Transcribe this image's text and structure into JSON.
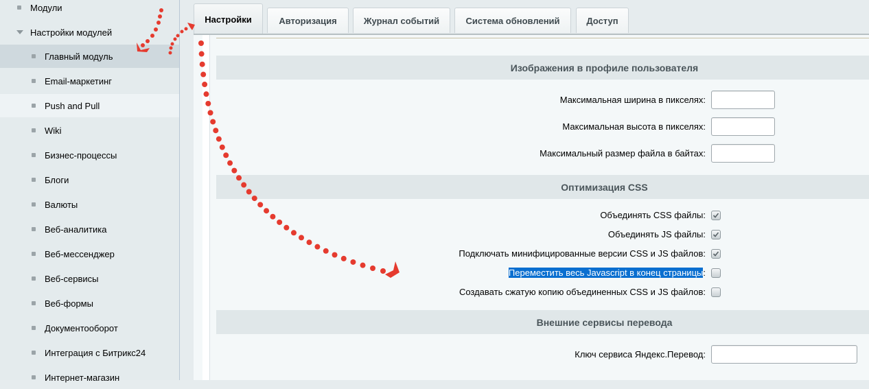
{
  "sidebar": {
    "items": [
      {
        "label": "Модули",
        "level": 1,
        "type": "bullet"
      },
      {
        "label": "Настройки модулей",
        "level": 1,
        "type": "expanded"
      },
      {
        "label": "Главный модуль",
        "level": 2,
        "type": "bullet",
        "state": "selected"
      },
      {
        "label": "Email-маркетинг",
        "level": 2,
        "type": "bullet"
      },
      {
        "label": "Push and Pull",
        "level": 2,
        "type": "bullet",
        "state": "hover"
      },
      {
        "label": "Wiki",
        "level": 2,
        "type": "bullet"
      },
      {
        "label": "Бизнес-процессы",
        "level": 2,
        "type": "bullet"
      },
      {
        "label": "Блоги",
        "level": 2,
        "type": "bullet"
      },
      {
        "label": "Валюты",
        "level": 2,
        "type": "bullet"
      },
      {
        "label": "Веб-аналитика",
        "level": 2,
        "type": "bullet"
      },
      {
        "label": "Веб-мессенджер",
        "level": 2,
        "type": "bullet"
      },
      {
        "label": "Веб-сервисы",
        "level": 2,
        "type": "bullet"
      },
      {
        "label": "Веб-формы",
        "level": 2,
        "type": "bullet"
      },
      {
        "label": "Документооборот",
        "level": 2,
        "type": "bullet"
      },
      {
        "label": "Интеграция с Битрикс24",
        "level": 2,
        "type": "bullet"
      },
      {
        "label": "Интернет-магазин",
        "level": 2,
        "type": "bullet"
      }
    ]
  },
  "tabs": [
    {
      "label": "Настройки",
      "active": true
    },
    {
      "label": "Авторизация",
      "active": false
    },
    {
      "label": "Журнал событий",
      "active": false
    },
    {
      "label": "Система обновлений",
      "active": false
    },
    {
      "label": "Доступ",
      "active": false
    }
  ],
  "sections": {
    "images": {
      "title": "Изображения в профиле пользователя",
      "fields": [
        {
          "label": "Максимальная ширина в пикселях:",
          "value": ""
        },
        {
          "label": "Максимальная высота в пикселях:",
          "value": ""
        },
        {
          "label": "Максимальный размер файла в байтах:",
          "value": ""
        }
      ]
    },
    "css": {
      "title": "Оптимизация CSS",
      "options": [
        {
          "label": "Объединять CSS файлы",
          "checked": true
        },
        {
          "label": "Объединять JS файлы",
          "checked": true
        },
        {
          "label": "Подключать минифицированные версии CSS и JS файлов",
          "checked": true
        },
        {
          "label": "Переместить весь Javascript в конец страницы",
          "checked": false,
          "highlighted": true
        },
        {
          "label": "Создавать сжатую копию объединенных CSS и JS файлов",
          "checked": false
        }
      ],
      "colon": ":"
    },
    "translate": {
      "title": "Внешние сервисы перевода",
      "fields": [
        {
          "label": "Ключ сервиса Яндекс.Перевод:",
          "value": ""
        }
      ]
    }
  },
  "colors": {
    "highlight": "#0a6fd0",
    "annotation": "#e53b2f",
    "selected_item": "#cfd9de"
  }
}
